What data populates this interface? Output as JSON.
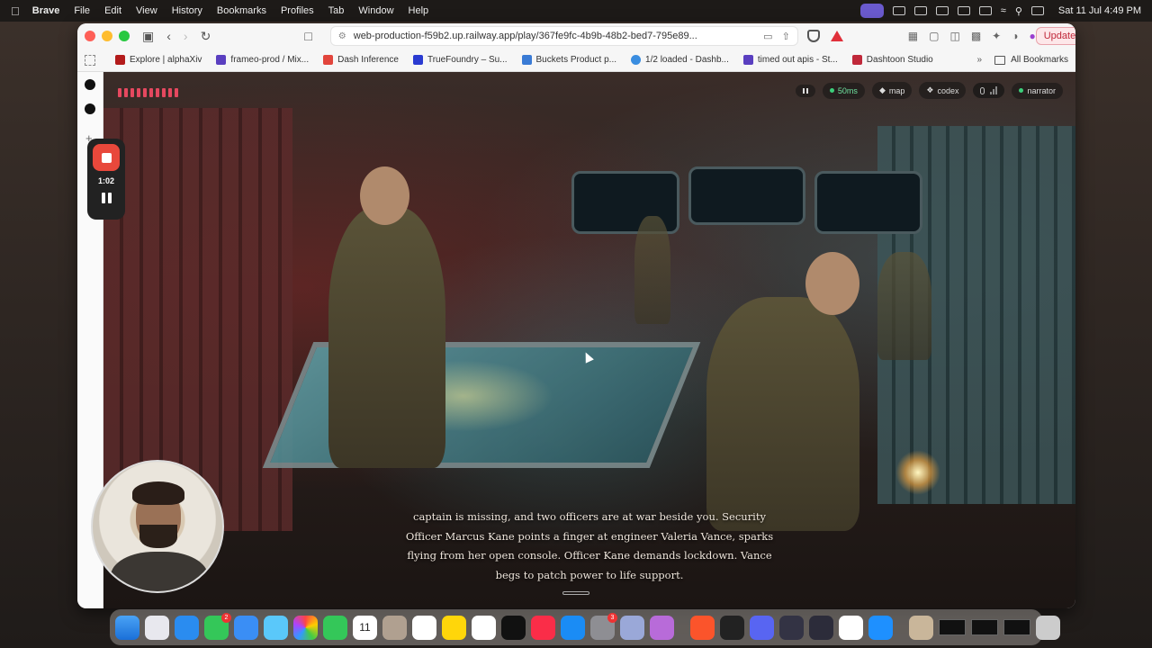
{
  "menubar": {
    "app_name": "Brave",
    "items": [
      "File",
      "Edit",
      "View",
      "History",
      "Bookmarks",
      "Profiles",
      "Tab",
      "Window",
      "Help"
    ],
    "datetime": "Sat 11 Jul  4:49 PM"
  },
  "browser": {
    "url": "web-production-f59b2.up.railway.app/play/367fe9fc-4b9b-48b2-bed7-795e89...",
    "update_label": "Update",
    "bookmarks": [
      {
        "label": "Explore | alphaXiv",
        "color": "#b31b1b"
      },
      {
        "label": "frameo-prod / Mix...",
        "color": "#5a3fc0"
      },
      {
        "label": "Dash Inference",
        "color": "#e2453c"
      },
      {
        "label": "TrueFoundry – Su...",
        "color": "#2a3bd1"
      },
      {
        "label": "Buckets Product p...",
        "color": "#3a7bd5"
      },
      {
        "label": "1/2 loaded - Dashb...",
        "color": "#3a8de0"
      },
      {
        "label": "timed out apis - St...",
        "color": "#5a3fc0"
      },
      {
        "label": "Dashtoon Studio",
        "color": "#c0283a"
      }
    ],
    "all_bookmarks_label": "All Bookmarks"
  },
  "recorder": {
    "time": "1:02"
  },
  "game": {
    "hud": {
      "latency": "50ms",
      "map_label": "map",
      "codex_label": "codex",
      "narrator_label": "narrator"
    },
    "narration": "captain is missing, and two officers are at war beside you. Security Officer Marcus Kane points a finger at engineer Valeria Vance, sparks flying from her open console. Officer Kane demands lockdown. Vance begs to patch power to life support."
  },
  "dock": {
    "calendar_day": "11",
    "badges": {
      "messages": "2",
      "settings": "3"
    }
  },
  "colors": {
    "accent_red": "#e5485f",
    "status_green": "#3ccf7a"
  }
}
